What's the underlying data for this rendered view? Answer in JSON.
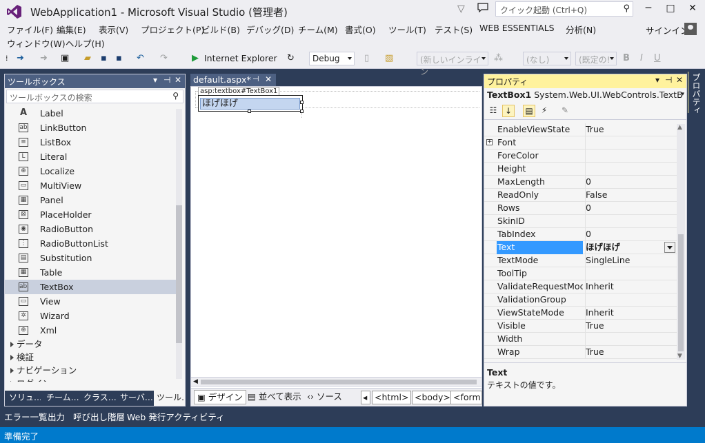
{
  "window": {
    "title": "WebApplication1 - Microsoft Visual Studio (管理者)",
    "quick_launch_placeholder": "クイック起動 (Ctrl+Q)",
    "controls": {
      "minimize": "─",
      "maximize": "□",
      "close": "✕"
    }
  },
  "menu": {
    "row1": [
      "ファイル(F)",
      "編集(E)",
      "表示(V)",
      "プロジェクト(P)",
      "ビルド(B)",
      "デバッグ(D)",
      "チーム(M)",
      "書式(O)",
      "ツール(T)",
      "テスト(S)",
      "WEB ESSENTIALS",
      "分析(N)"
    ],
    "row2": [
      "ウィンドウ(W)",
      "ヘルプ(H)"
    ],
    "signin": "サインイン"
  },
  "toolbar": {
    "browser": "Internet Explorer",
    "config": "Debug",
    "block_format": "(新しいインライン",
    "font_name": "(なし)",
    "font_size": "(既定の!",
    "bold": "B",
    "italic": "I",
    "underline": "U"
  },
  "toolbox": {
    "title": "ツールボックス",
    "search_placeholder": "ツールボックスの検索",
    "items": [
      {
        "label": "Label",
        "icon": "A"
      },
      {
        "label": "LinkButton",
        "icon": "ab"
      },
      {
        "label": "ListBox",
        "icon": "≡"
      },
      {
        "label": "Literal",
        "icon": "L"
      },
      {
        "label": "Localize",
        "icon": "⊕"
      },
      {
        "label": "MultiView",
        "icon": "▭"
      },
      {
        "label": "Panel",
        "icon": "▦"
      },
      {
        "label": "PlaceHolder",
        "icon": "⊠"
      },
      {
        "label": "RadioButton",
        "icon": "◉"
      },
      {
        "label": "RadioButtonList",
        "icon": "⋮"
      },
      {
        "label": "Substitution",
        "icon": "▤"
      },
      {
        "label": "Table",
        "icon": "▦"
      },
      {
        "label": "TextBox",
        "icon": "abl"
      },
      {
        "label": "View",
        "icon": "▭"
      },
      {
        "label": "Wizard",
        "icon": "✲"
      },
      {
        "label": "Xml",
        "icon": "⊕"
      }
    ],
    "selected_item": "TextBox",
    "groups": [
      "データ",
      "検証",
      "ナビゲーション",
      "ログイン"
    ],
    "tabs": [
      "ソリュ…",
      "チーム…",
      "クラス…",
      "サーバ…",
      "ツール…"
    ]
  },
  "editor": {
    "tab_label": "default.aspx*",
    "element_tag": "asp:textbox#TextBox1",
    "textbox_value": "ほげほげ",
    "views": [
      "デザイン",
      "並べて表示",
      "ソース"
    ],
    "active_view": "デザイン",
    "breadcrumbs": [
      "<html>",
      "<body>",
      "<form>"
    ]
  },
  "properties": {
    "title": "プロパティ",
    "object_name": "TextBox1",
    "object_type": "System.Web.UI.WebControls.TextB",
    "rows": [
      {
        "name": "EnableViewState",
        "value": "True"
      },
      {
        "name": "Font",
        "value": "",
        "expandable": true
      },
      {
        "name": "ForeColor",
        "value": ""
      },
      {
        "name": "Height",
        "value": ""
      },
      {
        "name": "MaxLength",
        "value": "0"
      },
      {
        "name": "ReadOnly",
        "value": "False"
      },
      {
        "name": "Rows",
        "value": "0"
      },
      {
        "name": "SkinID",
        "value": ""
      },
      {
        "name": "TabIndex",
        "value": "0"
      },
      {
        "name": "Text",
        "value": "ほげほげ",
        "selected": true
      },
      {
        "name": "TextMode",
        "value": "SingleLine"
      },
      {
        "name": "ToolTip",
        "value": ""
      },
      {
        "name": "ValidateRequestMode",
        "value": "Inherit"
      },
      {
        "name": "ValidationGroup",
        "value": ""
      },
      {
        "name": "ViewStateMode",
        "value": "Inherit"
      },
      {
        "name": "Visible",
        "value": "True"
      },
      {
        "name": "Width",
        "value": ""
      },
      {
        "name": "Wrap",
        "value": "True"
      }
    ],
    "description_title": "Text",
    "description_text": "テキストの値です。",
    "side_tab": "プロパティ"
  },
  "bottom_tabs": [
    "エラー一覧",
    "出力",
    "呼び出し階層",
    "Web 発行アクティビティ"
  ],
  "status": "準備完了",
  "colors": {
    "accent": "#007acc",
    "panel_header": "#4d6082",
    "active_header": "#fff29d",
    "selection": "#3399ff",
    "background": "#2d3d58"
  }
}
